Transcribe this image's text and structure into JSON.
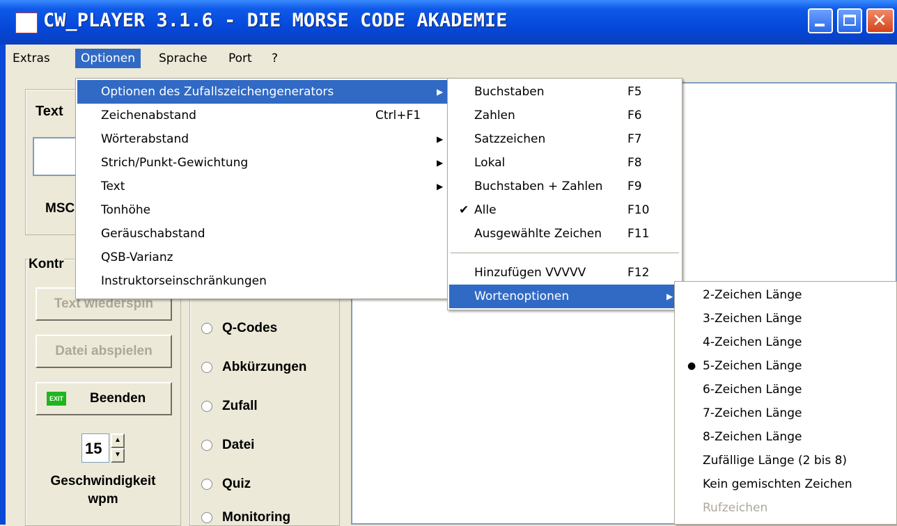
{
  "window": {
    "title": "CW_PLAYER 3.1.6 - DIE MORSE CODE AKADEMIE"
  },
  "menubar": {
    "items": [
      "Extras",
      "Optionen",
      "Sprache",
      "Port",
      "?"
    ]
  },
  "left_panel": {
    "text_group_label": "Text",
    "msc_label": "MSC",
    "control_group_label": "Kontr",
    "btn_text_replay": "Text wiederspin",
    "btn_play_file": "Datei abspielen",
    "btn_exit": "Beenden",
    "exit_icon_text": "EXIT",
    "speed_value": "15",
    "speed_label_1": "Geschwindigkeit",
    "speed_label_2": "wpm"
  },
  "mode_radios": [
    "Q-Codes",
    "Abkürzungen",
    "Zufall",
    "Datei",
    "Quiz",
    "Monitoring"
  ],
  "menu_optionen": {
    "items": [
      {
        "label": "Optionen des Zufallszeichengenerators",
        "shortcut": "",
        "submenu": true
      },
      {
        "label": "Zeichenabstand",
        "shortcut": "Ctrl+F1",
        "submenu": false
      },
      {
        "label": "Wörterabstand",
        "shortcut": "",
        "submenu": true
      },
      {
        "label": "Strich/Punkt-Gewichtung",
        "shortcut": "",
        "submenu": true
      },
      {
        "label": "Text",
        "shortcut": "",
        "submenu": true
      },
      {
        "label": "Tonhöhe",
        "shortcut": "",
        "submenu": false
      },
      {
        "label": "Geräuschabstand",
        "shortcut": "",
        "submenu": false
      },
      {
        "label": "QSB-Varianz",
        "shortcut": "",
        "submenu": false
      },
      {
        "label": "Instruktorseinschränkungen",
        "shortcut": "",
        "submenu": false
      }
    ]
  },
  "menu_generator": {
    "items": [
      {
        "label": "Buchstaben",
        "shortcut": "F5"
      },
      {
        "label": "Zahlen",
        "shortcut": "F6"
      },
      {
        "label": "Satzzeichen",
        "shortcut": "F7"
      },
      {
        "label": "Lokal",
        "shortcut": "F8"
      },
      {
        "label": "Buchstaben + Zahlen",
        "shortcut": "F9"
      },
      {
        "label": "Alle",
        "shortcut": "F10",
        "checked": true
      },
      {
        "label": "Ausgewählte Zeichen",
        "shortcut": "F11"
      },
      {
        "label": "Hinzufügen VVVVV",
        "shortcut": "F12"
      },
      {
        "label": "Wortenoptionen",
        "shortcut": "",
        "submenu": true
      }
    ]
  },
  "menu_wortenoptionen": {
    "items": [
      {
        "label": "2-Zeichen Länge"
      },
      {
        "label": "3-Zeichen Länge"
      },
      {
        "label": "4-Zeichen Länge"
      },
      {
        "label": "5-Zeichen Länge",
        "selected_bullet": true
      },
      {
        "label": "6-Zeichen Länge"
      },
      {
        "label": "7-Zeichen Länge"
      },
      {
        "label": "8-Zeichen Länge"
      },
      {
        "label": "Zufällige Länge (2 bis 8)"
      },
      {
        "label": "Kein gemischten Zeichen"
      },
      {
        "label": "Rufzeichen",
        "disabled": true
      }
    ]
  }
}
